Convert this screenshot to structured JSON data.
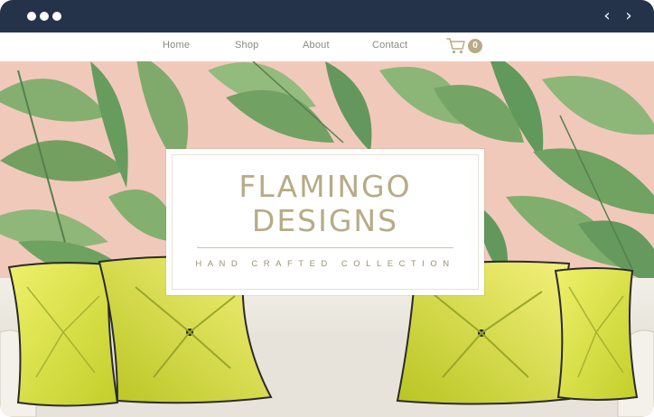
{
  "browser": {
    "dots": [
      "dot",
      "dot",
      "dot"
    ],
    "back_icon": "‹",
    "forward_icon": "›"
  },
  "nav": {
    "links": [
      "Home",
      "Shop",
      "About",
      "Contact"
    ],
    "cart_count": "0"
  },
  "hero": {
    "title_line1": "FLAMINGO",
    "title_line2": "DESIGNS",
    "subtitle": "HAND CRAFTED COLLECTION"
  },
  "colors": {
    "chrome": "#25334a",
    "accent": "#b7ab86",
    "hero_background": "#f1c9ba",
    "leaf_green": "#5f9a5a",
    "pillow_yellow": "#d8df3e"
  }
}
